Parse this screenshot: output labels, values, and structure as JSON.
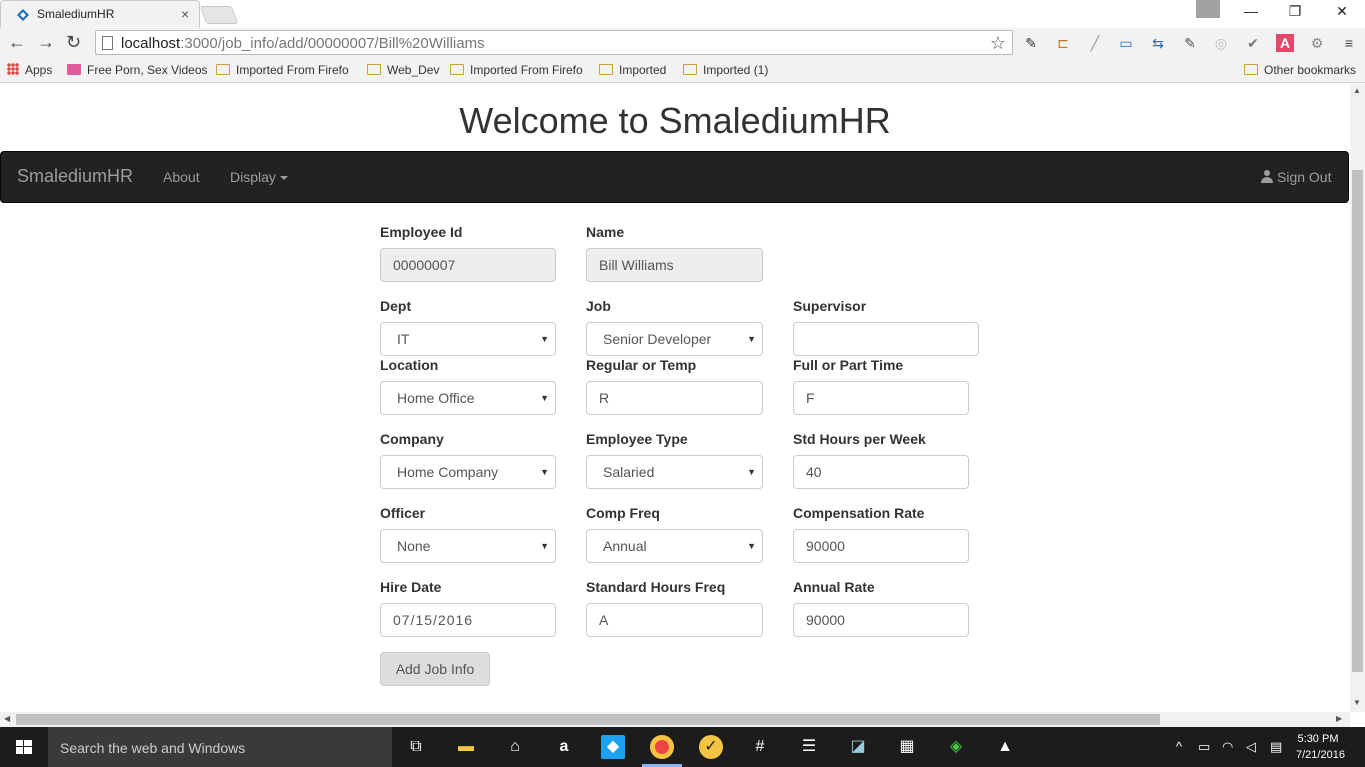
{
  "browser": {
    "tab_title": "SmalediumHR",
    "tab_close": "×",
    "url_host": "localhost",
    "url_path": ":3000/job_info/add/00000007/Bill%20Williams",
    "back": "←",
    "forward": "→",
    "reload": "↻",
    "star": "☆",
    "window_controls": {
      "minimize": "—",
      "maximize": "❐",
      "close": "✕"
    }
  },
  "bookmarks": [
    {
      "label": "Apps",
      "icon": "apps-grid-icon"
    },
    {
      "label": "Free Porn, Sex Videos",
      "icon": "site-icon"
    },
    {
      "label": "Imported From Firefo",
      "icon": "folder-icon"
    },
    {
      "label": "Web_Dev",
      "icon": "folder-icon"
    },
    {
      "label": "Imported From Firefo",
      "icon": "folder-icon"
    },
    {
      "label": "Imported",
      "icon": "folder-icon"
    },
    {
      "label": "Imported (1)",
      "icon": "folder-icon"
    },
    {
      "label": "Other bookmarks",
      "icon": "folder-icon"
    }
  ],
  "site": {
    "heading": "Welcome to SmalediumHR",
    "brand": "SmalediumHR",
    "nav": {
      "about": "About",
      "display": "Display",
      "sign_out": "Sign Out"
    }
  },
  "form": {
    "employee_id": {
      "label": "Employee Id",
      "value": "00000007"
    },
    "name": {
      "label": "Name",
      "value": "Bill Williams"
    },
    "dept": {
      "label": "Dept",
      "value": "IT"
    },
    "job": {
      "label": "Job",
      "value": "Senior Developer"
    },
    "supervisor": {
      "label": "Supervisor",
      "value": ""
    },
    "location": {
      "label": "Location",
      "value": "Home Office"
    },
    "regular_temp": {
      "label": "Regular or Temp",
      "value": "R"
    },
    "full_part": {
      "label": "Full or Part Time",
      "value": "F"
    },
    "company": {
      "label": "Company",
      "value": "Home Company"
    },
    "employee_type": {
      "label": "Employee Type",
      "value": "Salaried"
    },
    "std_hours": {
      "label": "Std Hours per Week",
      "value": "40"
    },
    "officer": {
      "label": "Officer",
      "value": "None"
    },
    "comp_freq": {
      "label": "Comp Freq",
      "value": "Annual"
    },
    "comp_rate": {
      "label": "Compensation Rate",
      "value": "90000"
    },
    "hire_date": {
      "label": "Hire Date",
      "value": "07/15/2016"
    },
    "std_hours_freq": {
      "label": "Standard Hours Freq",
      "value": "A"
    },
    "annual_rate": {
      "label": "Annual Rate",
      "value": "90000"
    },
    "submit": "Add Job Info",
    "select_arrow": "▼"
  },
  "taskbar": {
    "search_placeholder": "Search the web and Windows",
    "time": "5:30 PM",
    "date": "7/21/2016"
  }
}
